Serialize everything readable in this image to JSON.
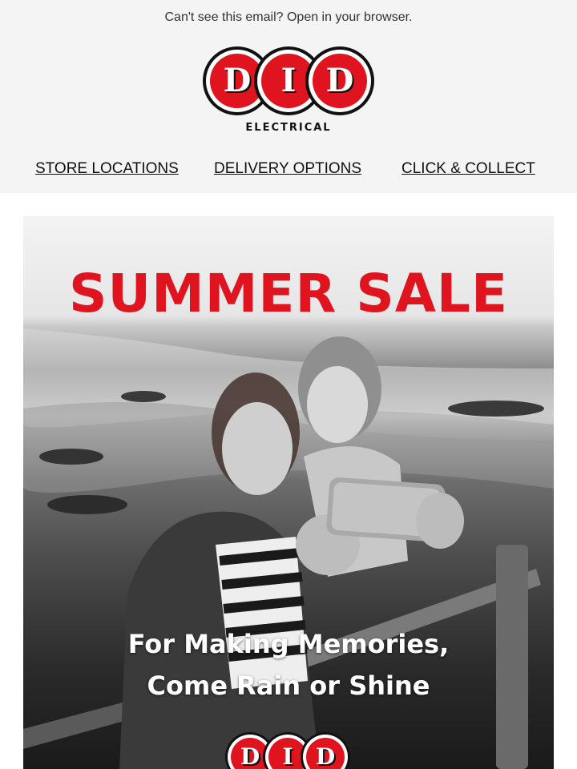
{
  "header": {
    "browser_prefix": "Can't see this email? ",
    "browser_link": "Open in your browser."
  },
  "logo": {
    "letters": [
      "D",
      "I",
      "D"
    ],
    "subtitle": "ELECTRICAL"
  },
  "nav": {
    "items": [
      {
        "label": "STORE LOCATIONS"
      },
      {
        "label": "DELIVERY OPTIONS"
      },
      {
        "label": "CLICK & COLLECT"
      }
    ]
  },
  "hero": {
    "title": "SUMMER SALE",
    "tagline_line1": "For Making Memories,",
    "tagline_line2": "Come Rain or Shine",
    "image_icon": "mother-daughter-selfie-photo",
    "logo_letters": [
      "D",
      "I",
      "D"
    ]
  },
  "colors": {
    "brand_red": "#e0141e",
    "background_top": "#f4f4f4",
    "text_dark": "#111111"
  }
}
